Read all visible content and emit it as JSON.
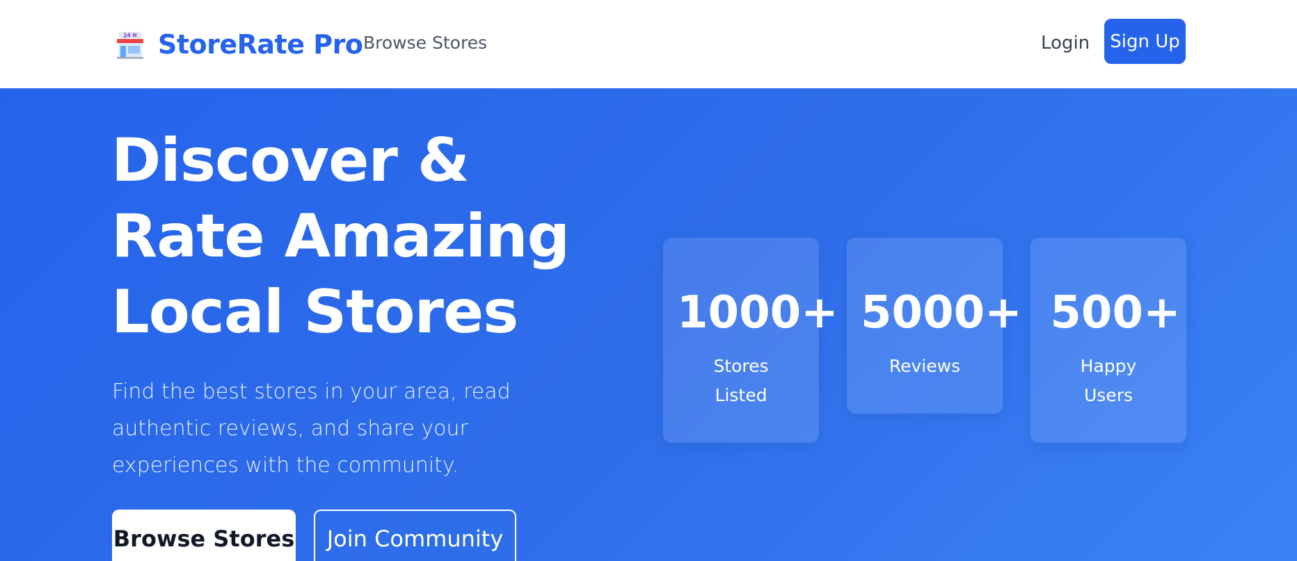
{
  "navbar": {
    "brand_name": "StoreRate Pro",
    "brand_icon": "store-24h-icon",
    "browse_link": "Browse Stores",
    "login_label": "Login",
    "signup_label": "Sign Up"
  },
  "hero": {
    "title": "Discover & Rate Amazing Local Stores",
    "subtitle": "Find the best stores in your area, read authentic reviews, and share your experiences with the community.",
    "primary_button": "Browse Stores",
    "secondary_button": "Join Community"
  },
  "stats": [
    {
      "value": "1000+",
      "label_lines": [
        "Stores",
        "Listed"
      ]
    },
    {
      "value": "5000+",
      "label_lines": [
        "Reviews"
      ]
    },
    {
      "value": "500+",
      "label_lines": [
        "Happy",
        "Users"
      ]
    }
  ],
  "colors": {
    "brand": "#2563eb",
    "hero_bg_start": "#2563eb",
    "hero_bg_end": "#3b82f6",
    "white": "#ffffff"
  }
}
